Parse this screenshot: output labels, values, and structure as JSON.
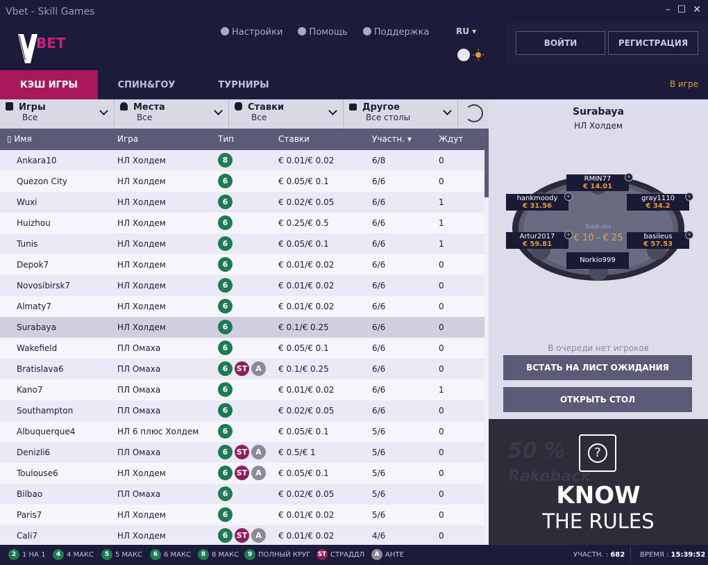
{
  "window": {
    "title": "Vbet - Skill Games"
  },
  "header": {
    "logo_text": "BET",
    "settings": "Настройки",
    "help": "Помощь",
    "support": "Поддержка",
    "lang": "RU",
    "login": "ВОЙТИ",
    "register": "РЕГИСТРАЦИЯ"
  },
  "tabs": [
    {
      "label": "КЭШ ИГРЫ",
      "active": true
    },
    {
      "label": "СПИН&ГОУ",
      "active": false
    },
    {
      "label": "ТУРНИРЫ",
      "active": false
    }
  ],
  "ingame": "В игре",
  "filters": [
    {
      "title": "Игры",
      "value": "Все",
      "icon": "cards-icon"
    },
    {
      "title": "Места",
      "value": "Все",
      "icon": "person-icon"
    },
    {
      "title": "Ставки",
      "value": "Все",
      "icon": "coins-icon"
    },
    {
      "title": "Другое",
      "value": "Все столы",
      "icon": "list-icon"
    }
  ],
  "columns": {
    "name": "Имя",
    "game": "Игра",
    "type": "Тип",
    "stakes": "Ставки",
    "players": "Участн.",
    "waiting": "Ждут"
  },
  "rows": [
    {
      "name": "Ankara10",
      "game": "НЛ Холдем",
      "badges": [
        "8"
      ],
      "stakes": "€ 0.01/€ 0.02",
      "players": "6/8",
      "waiting": "0"
    },
    {
      "name": "Quezon City",
      "game": "НЛ Холдем",
      "badges": [
        "6"
      ],
      "stakes": "€ 0.05/€ 0.1",
      "players": "6/6",
      "waiting": "0"
    },
    {
      "name": "Wuxi",
      "game": "НЛ Холдем",
      "badges": [
        "6"
      ],
      "stakes": "€ 0.02/€ 0.05",
      "players": "6/6",
      "waiting": "1"
    },
    {
      "name": "Huizhou",
      "game": "НЛ Холдем",
      "badges": [
        "6"
      ],
      "stakes": "€ 0.25/€ 0.5",
      "players": "6/6",
      "waiting": "1"
    },
    {
      "name": "Tunis",
      "game": "НЛ Холдем",
      "badges": [
        "6"
      ],
      "stakes": "€ 0.05/€ 0.1",
      "players": "6/6",
      "waiting": "1"
    },
    {
      "name": "Depok7",
      "game": "НЛ Холдем",
      "badges": [
        "6"
      ],
      "stakes": "€ 0.01/€ 0.02",
      "players": "6/6",
      "waiting": "0"
    },
    {
      "name": "Novosibirsk7",
      "game": "НЛ Холдем",
      "badges": [
        "6"
      ],
      "stakes": "€ 0.01/€ 0.02",
      "players": "6/6",
      "waiting": "0"
    },
    {
      "name": "Almaty7",
      "game": "НЛ Холдем",
      "badges": [
        "6"
      ],
      "stakes": "€ 0.01/€ 0.02",
      "players": "6/6",
      "waiting": "0"
    },
    {
      "name": "Surabaya",
      "game": "НЛ Холдем",
      "badges": [
        "6"
      ],
      "stakes": "€ 0.1/€ 0.25",
      "players": "6/6",
      "waiting": "0",
      "selected": true
    },
    {
      "name": "Wakefield",
      "game": "ПЛ Омаха",
      "badges": [
        "6"
      ],
      "stakes": "€ 0.05/€ 0.1",
      "players": "6/6",
      "waiting": "0"
    },
    {
      "name": "Bratislava6",
      "game": "ПЛ Омаха",
      "badges": [
        "6",
        "ST",
        "A"
      ],
      "stakes": "€ 0.1/€ 0.25",
      "players": "6/6",
      "waiting": "0"
    },
    {
      "name": "Kano7",
      "game": "ПЛ Омаха",
      "badges": [
        "6"
      ],
      "stakes": "€ 0.01/€ 0.02",
      "players": "6/6",
      "waiting": "1"
    },
    {
      "name": "Southampton",
      "game": "ПЛ Омаха",
      "badges": [
        "6"
      ],
      "stakes": "€ 0.02/€ 0.05",
      "players": "6/6",
      "waiting": "0"
    },
    {
      "name": "Albuquerque4",
      "game": "НЛ 6 плюс Холдем",
      "badges": [
        "6"
      ],
      "stakes": "€ 0.05/€ 0.1",
      "players": "5/6",
      "waiting": "0"
    },
    {
      "name": "Denizli6",
      "game": "ПЛ Омаха",
      "badges": [
        "6",
        "ST",
        "A"
      ],
      "stakes": "€ 0.5/€ 1",
      "players": "5/6",
      "waiting": "0"
    },
    {
      "name": "Toulouse6",
      "game": "НЛ Холдем",
      "badges": [
        "6",
        "ST",
        "A"
      ],
      "stakes": "€ 0.05/€ 0.1",
      "players": "5/6",
      "waiting": "0"
    },
    {
      "name": "Bilbao",
      "game": "ПЛ Омаха",
      "badges": [
        "6"
      ],
      "stakes": "€ 0.02/€ 0.05",
      "players": "5/6",
      "waiting": "0"
    },
    {
      "name": "Paris7",
      "game": "НЛ Холдем",
      "badges": [
        "6"
      ],
      "stakes": "€ 0.01/€ 0.02",
      "players": "5/6",
      "waiting": "0"
    },
    {
      "name": "Cali7",
      "game": "НЛ Холдем",
      "badges": [
        "6",
        "ST",
        "A"
      ],
      "stakes": "€ 0.01/€ 0.02",
      "players": "4/6",
      "waiting": "0"
    }
  ],
  "preview": {
    "table_name": "Surabaya",
    "game": "НЛ Холдем",
    "buyin_label": "Бай-ин",
    "buyin_value": "€ 10 - € 25",
    "seats": [
      {
        "name": "RMIN77",
        "amount": "€ 14.01"
      },
      {
        "name": "hankmoody",
        "amount": "€ 31.56"
      },
      {
        "name": "gray1110",
        "amount": "€ 34.2"
      },
      {
        "name": "Artur2017",
        "amount": "€ 59.81"
      },
      {
        "name": "basileus",
        "amount": "€ 57.53"
      },
      {
        "name": "Norkio999",
        "amount": ""
      }
    ],
    "queue_text": "В очереди нет игроков",
    "waitlist_button": "ВСТАТЬ НА ЛИСТ ОЖИДАНИЯ",
    "open_button": "ОТКРЫТЬ СТОЛ"
  },
  "promo": {
    "line1": "KNOW",
    "line2": "THE RULES",
    "bg_text1": "50 %",
    "bg_text2": "Rakeback"
  },
  "legend": [
    {
      "badge": "2",
      "label": "1 НА 1",
      "color": "#1d7a54"
    },
    {
      "badge": "4",
      "label": "4 МАКС",
      "color": "#1d7a54"
    },
    {
      "badge": "5",
      "label": "5 МАКС",
      "color": "#1d7a54"
    },
    {
      "badge": "6",
      "label": "6 МАКС",
      "color": "#1d7a54"
    },
    {
      "badge": "8",
      "label": "8 МАКС",
      "color": "#1d7a54"
    },
    {
      "badge": "9",
      "label": "ПОЛНЫЙ КРУГ",
      "color": "#1d7a54"
    },
    {
      "badge": "ST",
      "label": "СТРАДДЛ",
      "color": "#8c1e5c"
    },
    {
      "badge": "A",
      "label": "АНТЕ",
      "color": "#8a8a99"
    }
  ],
  "status": {
    "players_label": "УЧАСТН. :",
    "players_value": "682",
    "time_label": "ВРЕМЯ :",
    "time_value": "15:39:52"
  },
  "colors": {
    "accent": "#a8185a",
    "gold": "#e29a3c",
    "green": "#1d7a54"
  }
}
